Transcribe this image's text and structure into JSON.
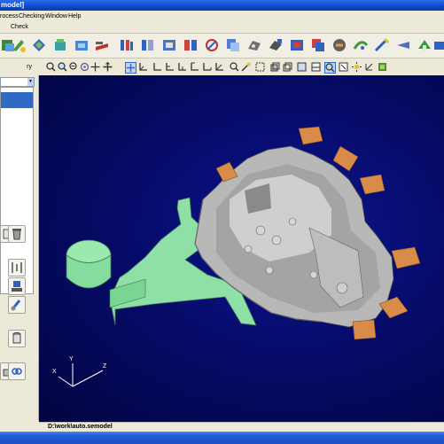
{
  "window": {
    "title": "model]"
  },
  "menu": [
    "rocess",
    "Checking",
    "Window",
    "Help"
  ],
  "check_toolbar": {
    "label": "Check"
  },
  "side_tab": {
    "label": "ry"
  },
  "status": {
    "path": "D:\\work\\auto.semodel"
  },
  "axes": {
    "x": "X",
    "y": "Y",
    "z": "Z"
  },
  "colors": {
    "viewport_bg": "#060b6a",
    "casting": "#b8b8b8",
    "runner": "#8fe0a6",
    "overflow": "#d98c4a",
    "selection": "#316ac5"
  }
}
